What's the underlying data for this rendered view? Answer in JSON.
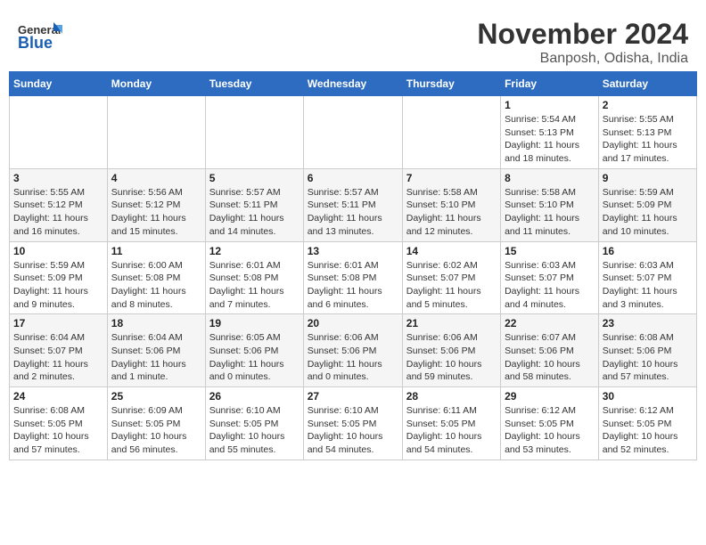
{
  "header": {
    "logo_general": "General",
    "logo_blue": "Blue",
    "title": "November 2024",
    "subtitle": "Banposh, Odisha, India"
  },
  "weekdays": [
    "Sunday",
    "Monday",
    "Tuesday",
    "Wednesday",
    "Thursday",
    "Friday",
    "Saturday"
  ],
  "weeks": [
    [
      {
        "day": "",
        "info": ""
      },
      {
        "day": "",
        "info": ""
      },
      {
        "day": "",
        "info": ""
      },
      {
        "day": "",
        "info": ""
      },
      {
        "day": "",
        "info": ""
      },
      {
        "day": "1",
        "info": "Sunrise: 5:54 AM\nSunset: 5:13 PM\nDaylight: 11 hours and 18 minutes."
      },
      {
        "day": "2",
        "info": "Sunrise: 5:55 AM\nSunset: 5:13 PM\nDaylight: 11 hours and 17 minutes."
      }
    ],
    [
      {
        "day": "3",
        "info": "Sunrise: 5:55 AM\nSunset: 5:12 PM\nDaylight: 11 hours and 16 minutes."
      },
      {
        "day": "4",
        "info": "Sunrise: 5:56 AM\nSunset: 5:12 PM\nDaylight: 11 hours and 15 minutes."
      },
      {
        "day": "5",
        "info": "Sunrise: 5:57 AM\nSunset: 5:11 PM\nDaylight: 11 hours and 14 minutes."
      },
      {
        "day": "6",
        "info": "Sunrise: 5:57 AM\nSunset: 5:11 PM\nDaylight: 11 hours and 13 minutes."
      },
      {
        "day": "7",
        "info": "Sunrise: 5:58 AM\nSunset: 5:10 PM\nDaylight: 11 hours and 12 minutes."
      },
      {
        "day": "8",
        "info": "Sunrise: 5:58 AM\nSunset: 5:10 PM\nDaylight: 11 hours and 11 minutes."
      },
      {
        "day": "9",
        "info": "Sunrise: 5:59 AM\nSunset: 5:09 PM\nDaylight: 11 hours and 10 minutes."
      }
    ],
    [
      {
        "day": "10",
        "info": "Sunrise: 5:59 AM\nSunset: 5:09 PM\nDaylight: 11 hours and 9 minutes."
      },
      {
        "day": "11",
        "info": "Sunrise: 6:00 AM\nSunset: 5:08 PM\nDaylight: 11 hours and 8 minutes."
      },
      {
        "day": "12",
        "info": "Sunrise: 6:01 AM\nSunset: 5:08 PM\nDaylight: 11 hours and 7 minutes."
      },
      {
        "day": "13",
        "info": "Sunrise: 6:01 AM\nSunset: 5:08 PM\nDaylight: 11 hours and 6 minutes."
      },
      {
        "day": "14",
        "info": "Sunrise: 6:02 AM\nSunset: 5:07 PM\nDaylight: 11 hours and 5 minutes."
      },
      {
        "day": "15",
        "info": "Sunrise: 6:03 AM\nSunset: 5:07 PM\nDaylight: 11 hours and 4 minutes."
      },
      {
        "day": "16",
        "info": "Sunrise: 6:03 AM\nSunset: 5:07 PM\nDaylight: 11 hours and 3 minutes."
      }
    ],
    [
      {
        "day": "17",
        "info": "Sunrise: 6:04 AM\nSunset: 5:07 PM\nDaylight: 11 hours and 2 minutes."
      },
      {
        "day": "18",
        "info": "Sunrise: 6:04 AM\nSunset: 5:06 PM\nDaylight: 11 hours and 1 minute."
      },
      {
        "day": "19",
        "info": "Sunrise: 6:05 AM\nSunset: 5:06 PM\nDaylight: 11 hours and 0 minutes."
      },
      {
        "day": "20",
        "info": "Sunrise: 6:06 AM\nSunset: 5:06 PM\nDaylight: 11 hours and 0 minutes."
      },
      {
        "day": "21",
        "info": "Sunrise: 6:06 AM\nSunset: 5:06 PM\nDaylight: 10 hours and 59 minutes."
      },
      {
        "day": "22",
        "info": "Sunrise: 6:07 AM\nSunset: 5:06 PM\nDaylight: 10 hours and 58 minutes."
      },
      {
        "day": "23",
        "info": "Sunrise: 6:08 AM\nSunset: 5:06 PM\nDaylight: 10 hours and 57 minutes."
      }
    ],
    [
      {
        "day": "24",
        "info": "Sunrise: 6:08 AM\nSunset: 5:05 PM\nDaylight: 10 hours and 57 minutes."
      },
      {
        "day": "25",
        "info": "Sunrise: 6:09 AM\nSunset: 5:05 PM\nDaylight: 10 hours and 56 minutes."
      },
      {
        "day": "26",
        "info": "Sunrise: 6:10 AM\nSunset: 5:05 PM\nDaylight: 10 hours and 55 minutes."
      },
      {
        "day": "27",
        "info": "Sunrise: 6:10 AM\nSunset: 5:05 PM\nDaylight: 10 hours and 54 minutes."
      },
      {
        "day": "28",
        "info": "Sunrise: 6:11 AM\nSunset: 5:05 PM\nDaylight: 10 hours and 54 minutes."
      },
      {
        "day": "29",
        "info": "Sunrise: 6:12 AM\nSunset: 5:05 PM\nDaylight: 10 hours and 53 minutes."
      },
      {
        "day": "30",
        "info": "Sunrise: 6:12 AM\nSunset: 5:05 PM\nDaylight: 10 hours and 52 minutes."
      }
    ]
  ]
}
